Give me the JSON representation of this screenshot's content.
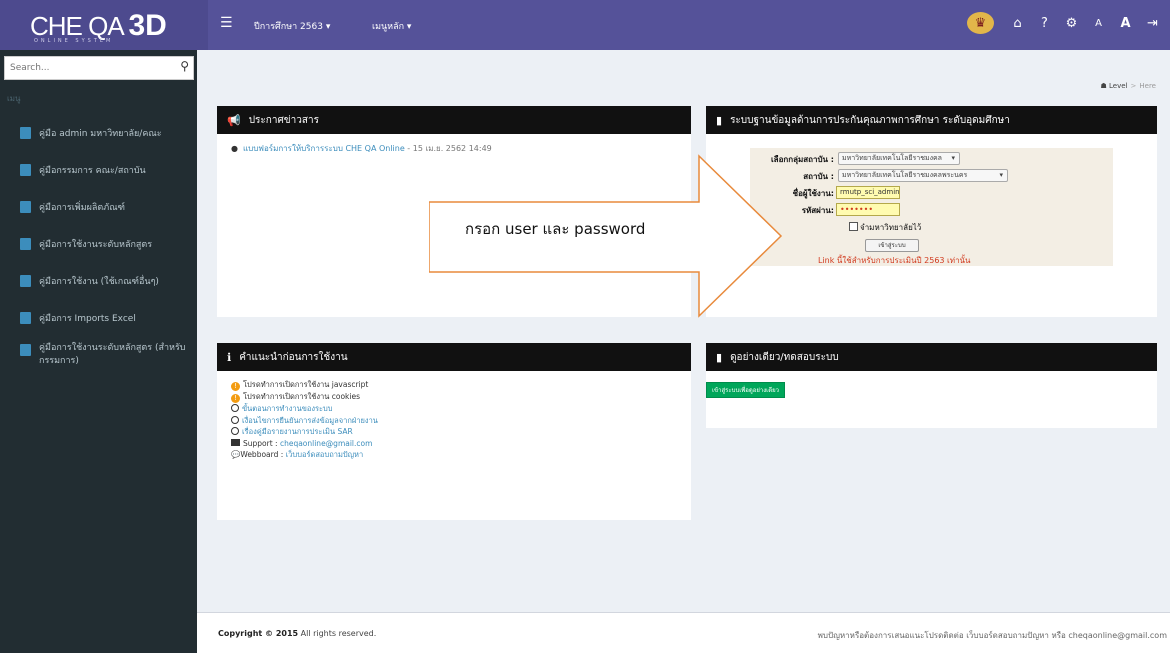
{
  "header": {
    "brand": "CHE QA",
    "brand_3d": "3D",
    "brand_sub": "ONLINE SYSTEM",
    "menu": [
      {
        "label": "ปีการศึกษา 2563 ▾"
      },
      {
        "label": "เมนูหลัก ▾"
      }
    ],
    "icons": [
      "home-icon",
      "help-icon",
      "settings-icon",
      "font-small-icon",
      "font-large-icon",
      "logout-icon"
    ]
  },
  "sidebar": {
    "search_placeholder": "Search...",
    "header": "เมนู",
    "items": [
      {
        "label": "คู่มือ admin มหาวิทยาลัย/คณะ"
      },
      {
        "label": "คู่มือกรรมการ คณะ/สถาบัน"
      },
      {
        "label": "คู่มือการเพิ่มผลิตภัณฑ์"
      },
      {
        "label": "คู่มือการใช้งานระดับหลักสูตร"
      },
      {
        "label": "คู่มือการใช้งาน (ใช้เกณฑ์อื่นๆ)"
      },
      {
        "label": "คู่มือการ Imports Excel"
      },
      {
        "label": "คู่มือการใช้งานระดับหลักสูตร (สำหรับกรรมการ)"
      }
    ]
  },
  "breadcrumb": {
    "level": "Level",
    "current": "Here"
  },
  "news": {
    "title": "ประกาศข่าวสาร",
    "items": [
      {
        "text": "แบบฟอร์มการให้บริการระบบ CHE QA Online",
        "date": " - 15 เม.ย. 2562 14:49"
      }
    ]
  },
  "login": {
    "title": "ระบบฐานข้อมูลด้านการประกันคุณภาพการศึกษา ระดับอุดมศึกษา",
    "group_label": "เลือกกลุ่มสถาบัน :",
    "group_value": "มหาวิทยาลัยเทคโนโลยีราชมงคล",
    "inst_label": "สถาบัน :",
    "inst_value": "มหาวิทยาลัยเทคโนโลยีราชมงคลพระนคร",
    "user_label": "ชื่อผู้ใช้งาน:",
    "user_value": "rmutp_sci_admin",
    "pass_label": "รหัสผ่าน:",
    "pass_value": "•••••••",
    "remember_label": "จำมหาวิทยาลัยไว้",
    "submit_label": "เข้าสู่ระบบ",
    "link_text": "Link นี้ใช้สำหรับการประเมินปี 2563 เท่านั้น"
  },
  "instructions": {
    "title": "คำแนะนำก่อนการใช้งาน",
    "items": [
      {
        "icon": "warning-icon",
        "text": "โปรดทำการเปิดการใช้งาน javascript"
      },
      {
        "icon": "warning-icon",
        "text": "โปรดทำการเปิดการใช้งาน cookies"
      },
      {
        "icon": "circle-icon",
        "text": "ขั้นตอนการทำงานของระบบ"
      },
      {
        "icon": "circle-icon",
        "text": "เงื่อนไขการยืนยันการส่งข้อมูลจากฝ่ายงาน"
      },
      {
        "icon": "circle-icon",
        "text": "เรื่องคู่มือรายงานการประเมิน SAR"
      }
    ],
    "support_label": "Support :",
    "support_value": "cheqaonline@gmail.com",
    "webboard_label": "Webboard :",
    "webboard_value": "เว็บบอร์ดสอบถามปัญหา"
  },
  "demo": {
    "title": "ดูอย่างเดียว/ทดสอบระบบ",
    "button": "เข้าสู่ระบบเพื่อดูอย่างเดียว"
  },
  "callout": {
    "text": "กรอก user และ password"
  },
  "footer": {
    "copyright": "Copyright © 2015",
    "rights": " All rights reserved.",
    "right_text": "พบปัญหาหรือต้องการเสนอแนะโปรดติดต่อ เว็บบอร์ดสอบถามปัญหา หรือ cheqaonline@gmail.com"
  }
}
